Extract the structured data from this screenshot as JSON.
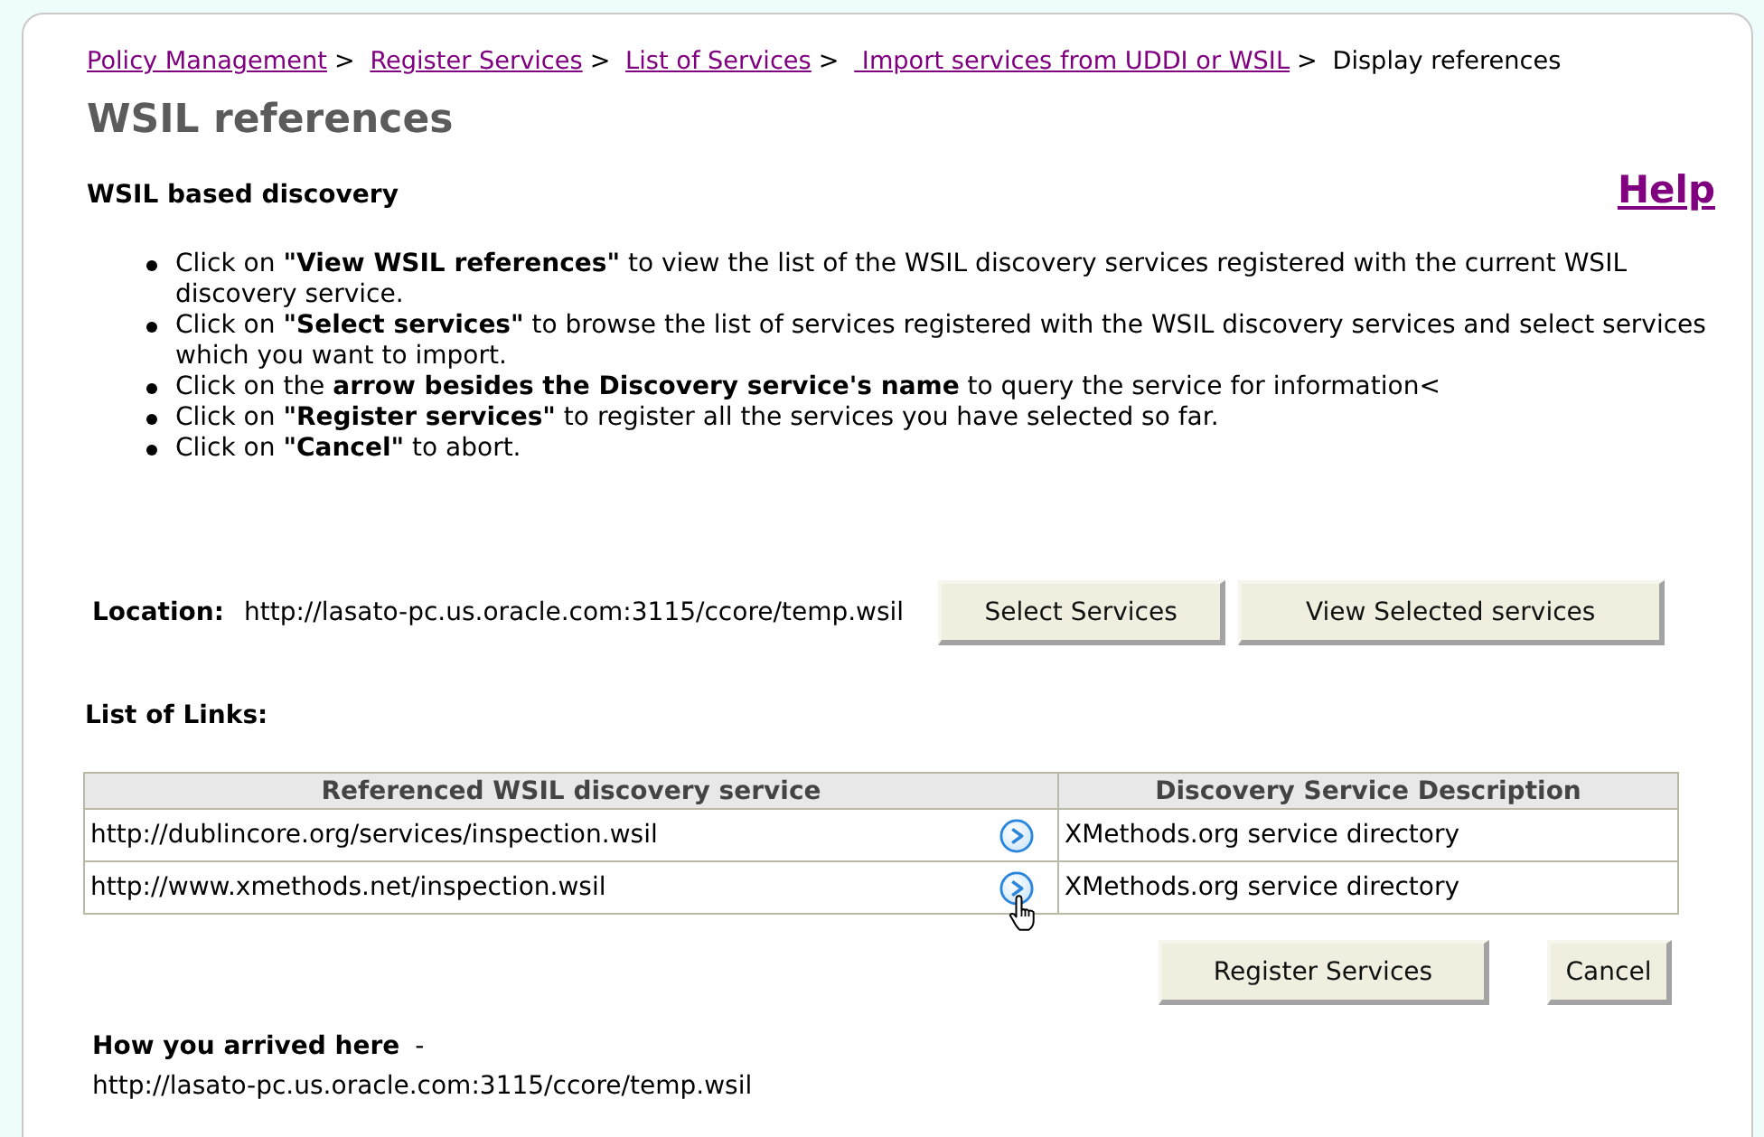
{
  "breadcrumb": {
    "separator": ">",
    "items": [
      {
        "label": "Policy Management",
        "kind": "link"
      },
      {
        "label": "Register Services",
        "kind": "link"
      },
      {
        "label": "List of Services",
        "kind": "link"
      },
      {
        "label": " Import services from UDDI or WSIL",
        "kind": "link"
      },
      {
        "label": "Display references",
        "kind": "current"
      }
    ]
  },
  "title": "WSIL references",
  "section_title": "WSIL based discovery",
  "help_link": "Help",
  "instructions": [
    "Click on **\"View WSIL references\"** to view the list of the WSIL discovery services registered with the current WSIL discovery service.",
    "Click on **\"Select services\"** to browse the list of services registered with the WSIL discovery services and select services which you want to import.",
    "Click on the **arrow besides the Discovery service's name** to query the service for information<",
    "Click on **\"Register services\"** to register all the services you have selected so far.",
    "Click on **\"Cancel\"** to abort."
  ],
  "location": {
    "label": "Location:",
    "value": "http://lasato-pc.us.oracle.com:3115/ccore/temp.wsil",
    "buttons": [
      "Select Services",
      "View Selected services"
    ]
  },
  "links_title": "List of Links:",
  "table": {
    "columns": [
      "Referenced WSIL discovery service",
      "Discovery Service Description"
    ],
    "rows": [
      {
        "service": "http://dublincore.org/services/inspection.wsil",
        "description": "XMethods.org service directory",
        "cursor_over_arrow": false
      },
      {
        "service": "http://www.xmethods.net/inspection.wsil",
        "description": "XMethods.org service directory",
        "cursor_over_arrow": true
      }
    ]
  },
  "action_buttons": [
    "Register Services",
    "Cancel"
  ],
  "arrived": {
    "label": "How you arrived here",
    "separator": "-",
    "value": "http://lasato-pc.us.oracle.com:3115/ccore/temp.wsil"
  }
}
